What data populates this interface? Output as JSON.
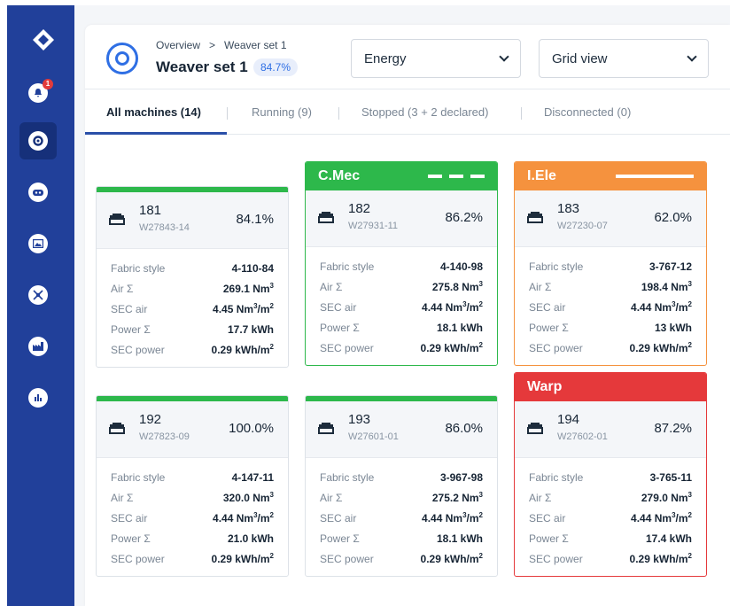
{
  "sidebar": {
    "notification_count": "1",
    "items": [
      {
        "icon": "bell-icon"
      },
      {
        "icon": "gear-icon",
        "active": true
      },
      {
        "icon": "robot-icon"
      },
      {
        "icon": "image-icon"
      },
      {
        "icon": "chart-network-icon"
      },
      {
        "icon": "factory-icon"
      },
      {
        "icon": "analytics-icon"
      }
    ]
  },
  "header": {
    "breadcrumb_root": "Overview",
    "breadcrumb_sep": ">",
    "breadcrumb_current": "Weaver set 1",
    "title": "Weaver set 1",
    "percentage": "84.7%",
    "metric_select": "Energy",
    "view_select": "Grid view"
  },
  "tabs": [
    {
      "label": "All machines (14)",
      "active": true
    },
    {
      "label": "Running (9)"
    },
    {
      "label": "Stopped (3 + 2 declared)"
    },
    {
      "label": "Disconnected (0)"
    }
  ],
  "labels": {
    "fabric": "Fabric style",
    "air": "Air Σ",
    "sec_air": "SEC air",
    "power": "Power Σ",
    "sec_power": "SEC power"
  },
  "colors": {
    "green": "#2db84b",
    "orange": "#f5923e",
    "red": "#e5393b"
  },
  "machines": [
    {
      "number": "181",
      "code": "W27843-14",
      "pct": "84.1%",
      "fabric": "4-110-84",
      "air": "269.1 Nm³",
      "sec_air": "4.45 Nm³/m²",
      "power": "17.7 kWh",
      "sec_power": "0.29 kWh/m²"
    },
    {
      "number": "182",
      "code": "W27931-11",
      "pct": "86.2%",
      "status_label": "C.Mec",
      "fabric": "4-140-98",
      "air": "275.8 Nm³",
      "sec_air": "4.44 Nm³/m²",
      "power": "18.1 kWh",
      "sec_power": "0.29 kWh/m²"
    },
    {
      "number": "183",
      "code": "W27230-07",
      "pct": "62.0%",
      "status_label": "I.Ele",
      "fabric": "3-767-12",
      "air": "198.4 Nm³",
      "sec_air": "4.44 Nm³/m²",
      "power": "13 kWh",
      "sec_power": "0.29 kWh/m²"
    },
    {
      "number": "192",
      "code": "W27823-09",
      "pct": "100.0%",
      "fabric": "4-147-11",
      "air": "320.0 Nm³",
      "sec_air": "4.44 Nm³/m²",
      "power": "21.0 kWh",
      "sec_power": "0.29 kWh/m²"
    },
    {
      "number": "193",
      "code": "W27601-01",
      "pct": "86.0%",
      "fabric": "3-967-98",
      "air": "275.2 Nm³",
      "sec_air": "4.44 Nm³/m²",
      "power": "18.1 kWh",
      "sec_power": "0.29 kWh/m²"
    },
    {
      "number": "194",
      "code": "W27602-01",
      "pct": "87.2%",
      "status_label": "Warp",
      "fabric": "3-765-11",
      "air": "279.0 Nm³",
      "sec_air": "4.44 Nm³/m²",
      "power": "17.4 kWh",
      "sec_power": "0.29 kWh/m²"
    }
  ]
}
